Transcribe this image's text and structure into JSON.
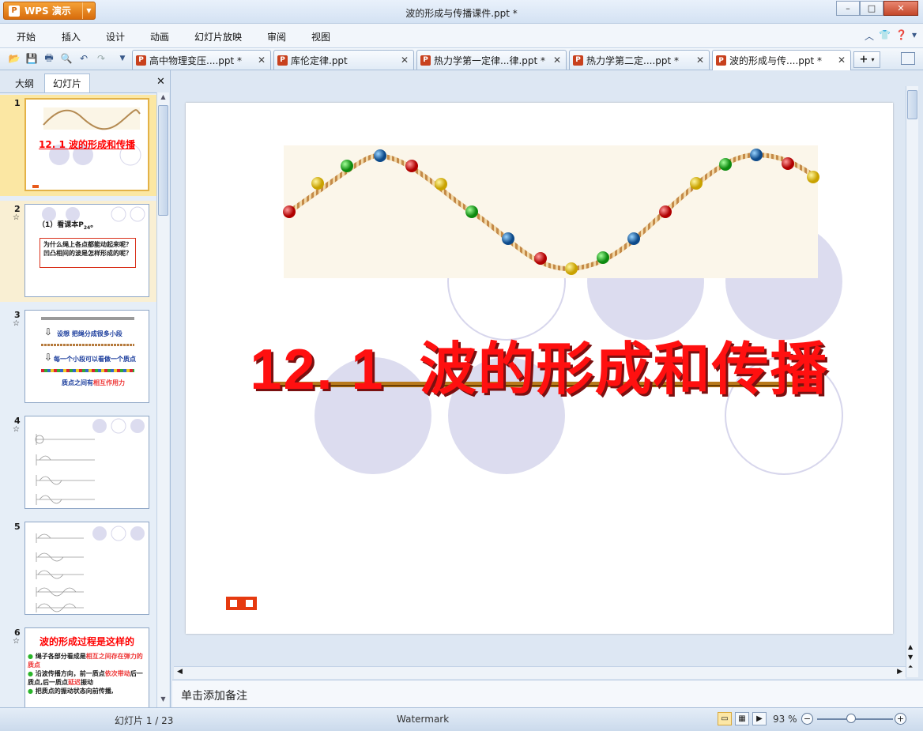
{
  "app": {
    "brand": "WPS 演示",
    "window_title": "波的形成与传播课件.ppt *"
  },
  "menu": [
    "开始",
    "插入",
    "设计",
    "动画",
    "幻灯片放映",
    "审阅",
    "视图"
  ],
  "tabs": [
    {
      "label": "高中物理变压....ppt *",
      "active": false
    },
    {
      "label": "库伦定律.ppt",
      "active": false
    },
    {
      "label": "热力学第一定律...律.ppt *",
      "active": false
    },
    {
      "label": "热力学第二定....ppt *",
      "active": false
    },
    {
      "label": "波的形成与传....ppt *",
      "active": true
    }
  ],
  "panel": {
    "tab_outline": "大纲",
    "tab_slides": "幻灯片"
  },
  "thumbnails": [
    {
      "num": "1",
      "title": "12. 1 波的形成和传播"
    },
    {
      "num": "2",
      "line1": "（1）看课本P",
      "sub": "24",
      "box": "为什么绳上各点都能动起来呢？凹凸相间的波是怎样形成的呢？"
    },
    {
      "num": "3",
      "t1": "设想  把绳分成很多小段",
      "t2": "每一个小段可以看做一个质点",
      "t3": "质点之间有",
      "t3r": "相互作用力"
    },
    {
      "num": "4"
    },
    {
      "num": "5"
    },
    {
      "num": "6",
      "title": "波的形成过程是这样的",
      "b1a": "绳子各部分看成是",
      "b1b": "相互之间存在弹力的质点",
      "b2a": "沿波传播方向，前一质点",
      "b2b": "依次带动",
      "b2c": "后一质点,后一质点",
      "b2d": "延迟",
      "b2e": "振动",
      "b3": "把质点的振动状态向前传播,"
    }
  ],
  "slide": {
    "title": "12. 1  波的形成和传播"
  },
  "notes": "单击添加备注",
  "status": {
    "slide_counter": "幻灯片 1 / 23",
    "watermark": "Watermark",
    "zoom": "93 %"
  }
}
